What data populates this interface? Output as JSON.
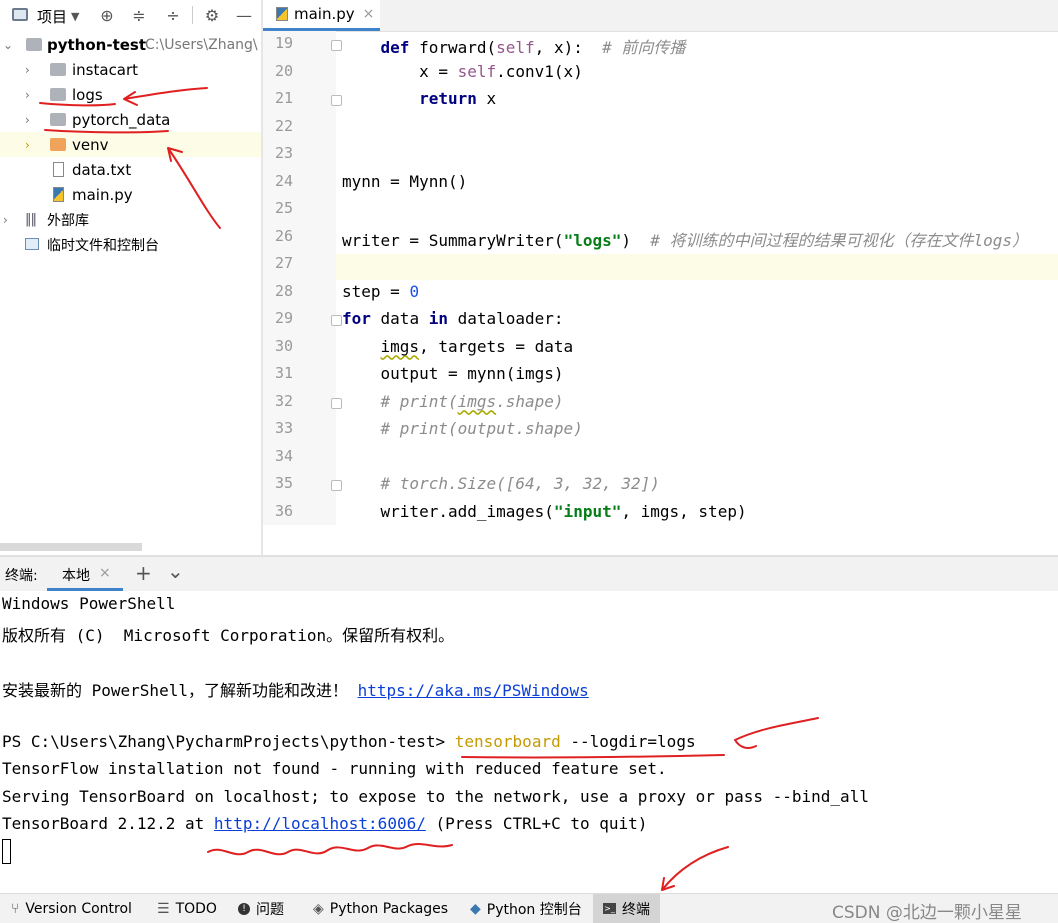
{
  "project_panel": {
    "title": "项目",
    "tree": [
      {
        "label": "python-test",
        "path": "C:\\Users\\Zhang\\"
      },
      {
        "label": "instacart"
      },
      {
        "label": "logs"
      },
      {
        "label": "pytorch_data"
      },
      {
        "label": "venv"
      },
      {
        "label": "data.txt"
      },
      {
        "label": "main.py"
      },
      {
        "label": "外部库"
      },
      {
        "label": "临时文件和控制台"
      }
    ]
  },
  "editor": {
    "tab": {
      "label": "main.py",
      "close": "×"
    },
    "lines": [
      {
        "no": "19",
        "parts": [
          {
            "t": "    "
          },
          {
            "t": "def",
            "c": "kw"
          },
          {
            "t": " forward("
          },
          {
            "t": "self",
            "c": "self"
          },
          {
            "t": ", x):  "
          },
          {
            "t": "# 前向传播",
            "c": "cmt"
          }
        ]
      },
      {
        "no": "20",
        "parts": [
          {
            "t": "        x = "
          },
          {
            "t": "self",
            "c": "self"
          },
          {
            "t": ".conv1(x)"
          }
        ]
      },
      {
        "no": "21",
        "parts": [
          {
            "t": "        "
          },
          {
            "t": "return",
            "c": "kw"
          },
          {
            "t": " x"
          }
        ]
      },
      {
        "no": "22",
        "parts": []
      },
      {
        "no": "23",
        "parts": []
      },
      {
        "no": "24",
        "parts": [
          {
            "t": "mynn = Mynn()"
          }
        ]
      },
      {
        "no": "25",
        "parts": []
      },
      {
        "no": "26",
        "parts": [
          {
            "t": "writer = SummaryWriter("
          },
          {
            "t": "\"logs\"",
            "c": "str"
          },
          {
            "t": ")  "
          },
          {
            "t": "# 将训练的中间过程的结果可视化（存在文件logs）",
            "c": "cmt"
          }
        ]
      },
      {
        "no": "27",
        "parts": []
      },
      {
        "no": "28",
        "parts": [
          {
            "t": "step = "
          },
          {
            "t": "0",
            "c": "num"
          }
        ]
      },
      {
        "no": "29",
        "parts": [
          {
            "t": "for",
            "c": "kw"
          },
          {
            "t": " data "
          },
          {
            "t": "in",
            "c": "kw"
          },
          {
            "t": " dataloader:"
          }
        ]
      },
      {
        "no": "30",
        "parts": [
          {
            "t": "    "
          },
          {
            "t": "imgs",
            "c": "wavy"
          },
          {
            "t": ", targets = data"
          }
        ]
      },
      {
        "no": "31",
        "parts": [
          {
            "t": "    output = mynn(imgs)"
          }
        ]
      },
      {
        "no": "32",
        "parts": [
          {
            "t": "    "
          },
          {
            "t": "# print(",
            "c": "cmt"
          },
          {
            "t": "imgs",
            "c": "cmt wavy"
          },
          {
            "t": ".shape)",
            "c": "cmt"
          }
        ]
      },
      {
        "no": "33",
        "parts": [
          {
            "t": "    "
          },
          {
            "t": "# print(output.shape)",
            "c": "cmt"
          }
        ]
      },
      {
        "no": "34",
        "parts": []
      },
      {
        "no": "35",
        "parts": [
          {
            "t": "    "
          },
          {
            "t": "# torch.Size([64, 3, 32, 32])",
            "c": "cmt"
          }
        ]
      },
      {
        "no": "36",
        "parts": [
          {
            "t": "    writer.add_images("
          },
          {
            "t": "\"input\"",
            "c": "str"
          },
          {
            "t": ", imgs, step)"
          }
        ]
      }
    ]
  },
  "terminal": {
    "label": "终端:",
    "tab": "本地",
    "tab_close": "×",
    "add": "+",
    "menu": "⌄",
    "lines": [
      {
        "parts": [
          {
            "t": "Windows PowerShell"
          }
        ]
      },
      {
        "parts": [
          {
            "t": "版权所有 (C)  Microsoft Corporation。保留所有权利。"
          }
        ]
      },
      {
        "parts": []
      },
      {
        "parts": [
          {
            "t": "安装最新的 PowerShell，了解新功能和改进！ "
          },
          {
            "t": "https://aka.ms/PSWindows",
            "c": "link"
          }
        ]
      },
      {
        "parts": []
      },
      {
        "parts": [
          {
            "t": "PS C:\\Users\\Zhang\\PycharmProjects\\python-test> "
          },
          {
            "t": "tensorboard",
            "c": "cmd"
          },
          {
            "t": " --logdir=logs"
          }
        ]
      },
      {
        "parts": [
          {
            "t": "TensorFlow installation not found - running with reduced feature set."
          }
        ]
      },
      {
        "parts": [
          {
            "t": "Serving TensorBoard on localhost; to expose to the network, use a proxy or pass --bind_all"
          }
        ]
      },
      {
        "parts": [
          {
            "t": "TensorBoard 2.12.2 at "
          },
          {
            "t": "http://localhost:6006/",
            "c": "link"
          },
          {
            "t": " (Press CTRL+C to quit)"
          }
        ]
      }
    ]
  },
  "status_bar": {
    "items": [
      {
        "label": "Version Control",
        "icon": "branch-icon"
      },
      {
        "label": "TODO",
        "icon": "list-icon"
      },
      {
        "label": "问题",
        "icon": "problem-icon"
      },
      {
        "label": "Python Packages",
        "icon": "packages-icon"
      },
      {
        "label": "Python 控制台",
        "icon": "python-icon"
      },
      {
        "label": "终端",
        "icon": "terminal-icon"
      }
    ],
    "watermark": "CSDN @北边一颗小星星"
  },
  "colors": {
    "accent": "#4083c9",
    "annotation": "#e02020",
    "current_line": "#fdfce6"
  }
}
